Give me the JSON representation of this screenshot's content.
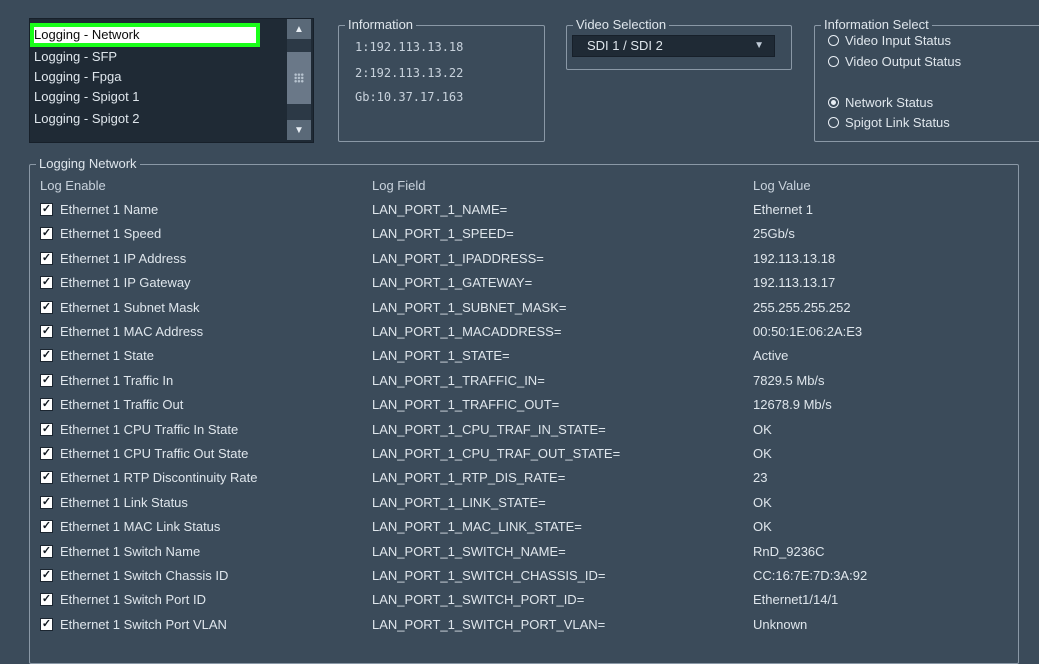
{
  "log_list": {
    "items": [
      "Logging - Network",
      "Logging - SFP",
      "Logging - Fpga",
      "Logging - Spigot 1",
      "Logging - Spigot 2"
    ],
    "selected_index": 0,
    "scroll_up": "▲",
    "scroll_down": "▼"
  },
  "information": {
    "title": "Information",
    "lines": [
      "1:192.113.13.18",
      "2:192.113.13.22",
      "Gb:10.37.17.163"
    ]
  },
  "video_selection": {
    "title": "Video Selection",
    "value": "SDI 1 / SDI 2",
    "arrow": "▼"
  },
  "information_select": {
    "title": "Information Select",
    "options": [
      {
        "label": "Video Input Status",
        "selected": false
      },
      {
        "label": "Video Output Status",
        "selected": false
      },
      {
        "label": "Network Status",
        "selected": true
      },
      {
        "label": "Spigot Link Status",
        "selected": false
      }
    ]
  },
  "logging_network": {
    "title": "Logging Network",
    "headers": {
      "enable": "Log Enable",
      "field": "Log Field",
      "value": "Log Value"
    },
    "check_mark": "✓",
    "rows": [
      {
        "name": "Ethernet 1 Name",
        "field": "LAN_PORT_1_NAME=",
        "value": "Ethernet 1"
      },
      {
        "name": "Ethernet 1 Speed",
        "field": "LAN_PORT_1_SPEED=",
        "value": "25Gb/s"
      },
      {
        "name": "Ethernet 1 IP Address",
        "field": "LAN_PORT_1_IPADDRESS=",
        "value": "192.113.13.18"
      },
      {
        "name": "Ethernet 1 IP Gateway",
        "field": "LAN_PORT_1_GATEWAY=",
        "value": "192.113.13.17"
      },
      {
        "name": "Ethernet 1 Subnet Mask",
        "field": "LAN_PORT_1_SUBNET_MASK=",
        "value": "255.255.255.252"
      },
      {
        "name": "Ethernet 1 MAC Address",
        "field": "LAN_PORT_1_MACADDRESS=",
        "value": "00:50:1E:06:2A:E3"
      },
      {
        "name": "Ethernet 1 State",
        "field": "LAN_PORT_1_STATE=",
        "value": "Active"
      },
      {
        "name": "Ethernet 1 Traffic In",
        "field": "LAN_PORT_1_TRAFFIC_IN=",
        "value": "7829.5 Mb/s"
      },
      {
        "name": "Ethernet 1 Traffic Out",
        "field": "LAN_PORT_1_TRAFFIC_OUT=",
        "value": "12678.9 Mb/s"
      },
      {
        "name": "Ethernet 1 CPU Traffic In State",
        "field": "LAN_PORT_1_CPU_TRAF_IN_STATE=",
        "value": "OK"
      },
      {
        "name": "Ethernet 1 CPU Traffic Out State",
        "field": "LAN_PORT_1_CPU_TRAF_OUT_STATE=",
        "value": "OK"
      },
      {
        "name": "Ethernet 1 RTP Discontinuity Rate",
        "field": "LAN_PORT_1_RTP_DIS_RATE=",
        "value": "23"
      },
      {
        "name": "Ethernet 1 Link Status",
        "field": "LAN_PORT_1_LINK_STATE=",
        "value": "OK"
      },
      {
        "name": "Ethernet 1 MAC Link Status",
        "field": "LAN_PORT_1_MAC_LINK_STATE=",
        "value": "OK"
      },
      {
        "name": "Ethernet 1 Switch Name",
        "field": "LAN_PORT_1_SWITCH_NAME=",
        "value": "RnD_9236C"
      },
      {
        "name": "Ethernet 1 Switch Chassis ID",
        "field": "LAN_PORT_1_SWITCH_CHASSIS_ID=",
        "value": "CC:16:7E:7D:3A:92"
      },
      {
        "name": "Ethernet 1 Switch Port ID",
        "field": "LAN_PORT_1_SWITCH_PORT_ID=",
        "value": "Ethernet1/14/1"
      },
      {
        "name": "Ethernet 1 Switch Port VLAN",
        "field": "LAN_PORT_1_SWITCH_PORT_VLAN=",
        "value": "Unknown"
      }
    ]
  },
  "colors": {
    "background": "#3b4b5a",
    "list_background": "#1f2a35",
    "highlight_border": "#19ff19"
  }
}
